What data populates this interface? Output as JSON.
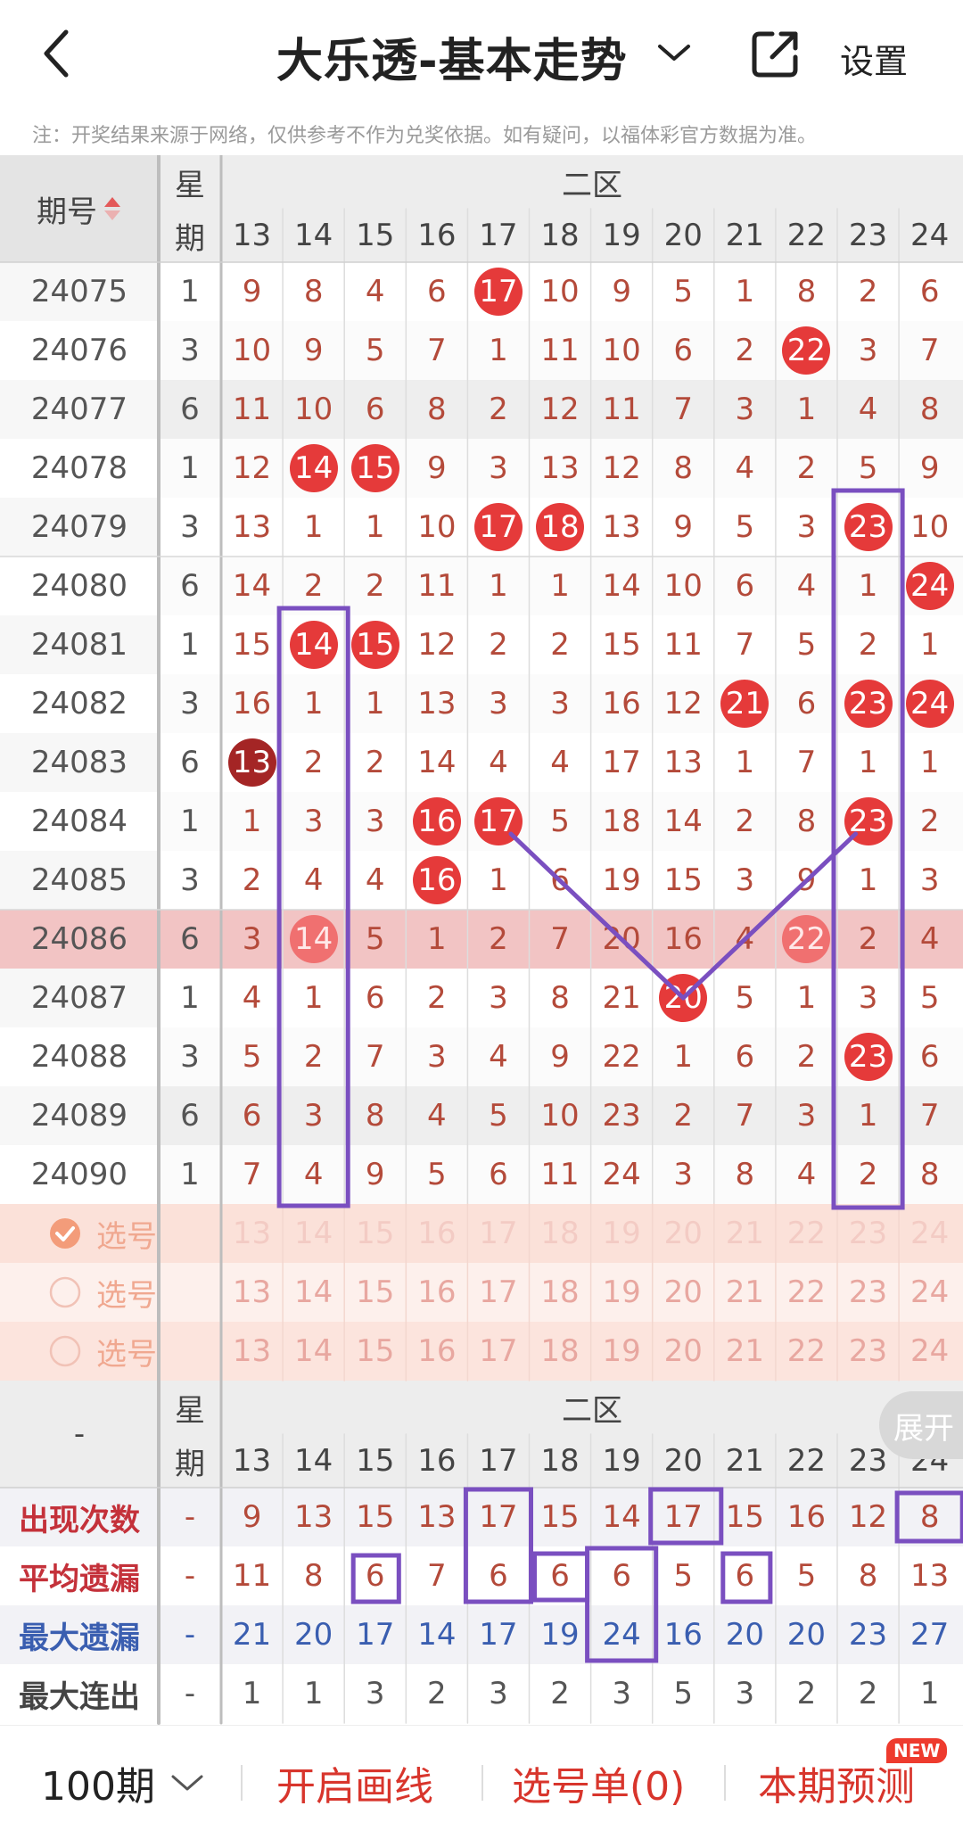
{
  "header": {
    "title": "大乐透-基本走势",
    "settings": "设置",
    "notice": "注：开奖结果来源于网络，仅供参考不作为兑奖依据。如有疑问，以福体彩官方数据为准。"
  },
  "table": {
    "col_issue_header": "期号",
    "col_week_header_top": "星",
    "col_week_header_bottom": "期",
    "zone_header": "二区",
    "numbers": [
      "13",
      "14",
      "15",
      "16",
      "17",
      "18",
      "19",
      "20",
      "21",
      "22",
      "23",
      "24"
    ],
    "rows": [
      {
        "issue": "24075",
        "week": "1",
        "cells": [
          "9",
          "8",
          "4",
          "6",
          "17",
          "10",
          "9",
          "5",
          "1",
          "8",
          "2",
          "6"
        ],
        "hits": [
          4
        ]
      },
      {
        "issue": "24076",
        "week": "3",
        "cells": [
          "10",
          "9",
          "5",
          "7",
          "1",
          "11",
          "10",
          "6",
          "2",
          "22",
          "3",
          "7"
        ],
        "hits": [
          9
        ]
      },
      {
        "issue": "24077",
        "week": "6",
        "cells": [
          "11",
          "10",
          "6",
          "8",
          "2",
          "12",
          "11",
          "7",
          "3",
          "1",
          "4",
          "8"
        ],
        "hits": []
      },
      {
        "issue": "24078",
        "week": "1",
        "cells": [
          "12",
          "14",
          "15",
          "9",
          "3",
          "13",
          "12",
          "8",
          "4",
          "2",
          "5",
          "9"
        ],
        "hits": [
          1,
          2
        ]
      },
      {
        "issue": "24079",
        "week": "3",
        "cells": [
          "13",
          "1",
          "1",
          "10",
          "17",
          "18",
          "13",
          "9",
          "5",
          "3",
          "23",
          "10"
        ],
        "hits": [
          4,
          5,
          10
        ]
      },
      {
        "issue": "24080",
        "week": "6",
        "cells": [
          "14",
          "2",
          "2",
          "11",
          "1",
          "1",
          "14",
          "10",
          "6",
          "4",
          "1",
          "24"
        ],
        "hits": [
          11
        ]
      },
      {
        "issue": "24081",
        "week": "1",
        "cells": [
          "15",
          "14",
          "15",
          "12",
          "2",
          "2",
          "15",
          "11",
          "7",
          "5",
          "2",
          "1"
        ],
        "hits": [
          1,
          2
        ]
      },
      {
        "issue": "24082",
        "week": "3",
        "cells": [
          "16",
          "1",
          "1",
          "13",
          "3",
          "3",
          "16",
          "12",
          "21",
          "6",
          "23",
          "24"
        ],
        "hits": [
          8,
          10,
          11
        ]
      },
      {
        "issue": "24083",
        "week": "6",
        "cells": [
          "13",
          "2",
          "2",
          "14",
          "4",
          "4",
          "17",
          "13",
          "1",
          "7",
          "1",
          "1"
        ],
        "hits": [
          0
        ]
      },
      {
        "issue": "24084",
        "week": "1",
        "cells": [
          "1",
          "3",
          "3",
          "16",
          "17",
          "5",
          "18",
          "14",
          "2",
          "8",
          "23",
          "2"
        ],
        "hits": [
          3,
          4,
          10
        ]
      },
      {
        "issue": "24085",
        "week": "3",
        "cells": [
          "2",
          "4",
          "4",
          "16",
          "1",
          "6",
          "19",
          "15",
          "3",
          "9",
          "1",
          "3"
        ],
        "hits": [
          3
        ]
      },
      {
        "issue": "24086",
        "week": "6",
        "cells": [
          "3",
          "14",
          "5",
          "1",
          "2",
          "7",
          "20",
          "16",
          "4",
          "22",
          "2",
          "4"
        ],
        "hits": [
          1,
          9
        ]
      },
      {
        "issue": "24087",
        "week": "1",
        "cells": [
          "4",
          "1",
          "6",
          "2",
          "3",
          "8",
          "21",
          "20",
          "5",
          "1",
          "3",
          "5"
        ],
        "hits": [
          7
        ]
      },
      {
        "issue": "24088",
        "week": "3",
        "cells": [
          "5",
          "2",
          "7",
          "3",
          "4",
          "9",
          "22",
          "1",
          "6",
          "2",
          "23",
          "6"
        ],
        "hits": [
          10
        ]
      },
      {
        "issue": "24089",
        "week": "6",
        "cells": [
          "6",
          "3",
          "8",
          "4",
          "5",
          "10",
          "23",
          "2",
          "7",
          "3",
          "1",
          "7"
        ],
        "hits": []
      },
      {
        "issue": "24090",
        "week": "1",
        "cells": [
          "7",
          "4",
          "9",
          "5",
          "6",
          "11",
          "24",
          "3",
          "8",
          "4",
          "2",
          "8"
        ],
        "hits": []
      }
    ],
    "select_rows": [
      {
        "label": "选号",
        "checked": true
      },
      {
        "label": "选号",
        "checked": false
      },
      {
        "label": "选号",
        "checked": false
      }
    ]
  },
  "stats": {
    "col_issue_header": "-",
    "week_top": "星",
    "week_bottom": "期",
    "zone_header": "二区",
    "expand_label": "展开",
    "rows": [
      {
        "label": "出现次数",
        "label_color": "#c4313a",
        "week": "-",
        "values": [
          "9",
          "13",
          "15",
          "13",
          "17",
          "15",
          "14",
          "17",
          "15",
          "16",
          "12",
          "8"
        ],
        "value_color": "#b44a3a"
      },
      {
        "label": "平均遗漏",
        "label_color": "#c4313a",
        "week": "-",
        "values": [
          "11",
          "8",
          "6",
          "7",
          "6",
          "6",
          "6",
          "5",
          "6",
          "5",
          "8",
          "13"
        ],
        "value_color": "#b44a3a"
      },
      {
        "label": "最大遗漏",
        "label_color": "#3a5eb0",
        "week": "-",
        "values": [
          "21",
          "20",
          "17",
          "14",
          "17",
          "19",
          "24",
          "16",
          "20",
          "20",
          "23",
          "27"
        ],
        "value_color": "#3a5eb0"
      },
      {
        "label": "最大连出",
        "label_color": "#444444",
        "week": "-",
        "values": [
          "1",
          "1",
          "3",
          "2",
          "3",
          "2",
          "3",
          "5",
          "3",
          "2",
          "2",
          "1"
        ],
        "value_color": "#555555"
      }
    ]
  },
  "footer": {
    "period": "100期",
    "draw_line": "开启画线",
    "pick_list": "选号单(0)",
    "predict": "本期预测",
    "new_badge": "NEW"
  },
  "colors": {
    "ball": "#e53a3a",
    "accent_text": "#c4313a",
    "annotation": "#7a4fc0"
  }
}
